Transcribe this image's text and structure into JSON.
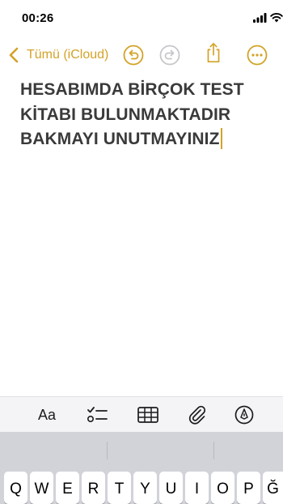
{
  "status_bar": {
    "time": "00:26"
  },
  "nav": {
    "back_label": "Tümü (iCloud)",
    "accent_color": "#d3a328",
    "icons": [
      "chevron-left-icon",
      "undo-icon",
      "redo-icon",
      "share-icon",
      "more-icon"
    ],
    "redo_enabled": false
  },
  "note": {
    "lines": [
      "HESABIMDA BİRÇOK TEST",
      "KİTABI BULUNMAKTADIR",
      "BAKMAYI UNUTMAYINIZ"
    ]
  },
  "toolbar": {
    "text_format_label": "Aa",
    "icons": [
      "checklist-icon",
      "table-icon",
      "paperclip-icon",
      "markup-pen-icon"
    ]
  },
  "keyboard": {
    "top_row": [
      "Q",
      "W",
      "E",
      "R",
      "T",
      "Y",
      "U",
      "I",
      "O",
      "P",
      "Ğ"
    ]
  }
}
